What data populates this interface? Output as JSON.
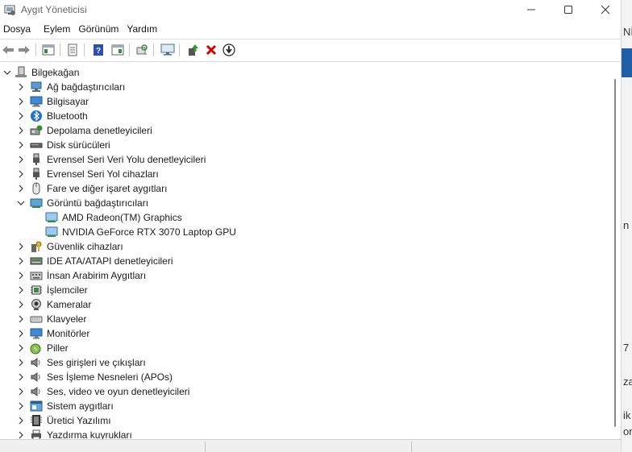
{
  "window": {
    "title": "Aygıt Yöneticisi"
  },
  "menu": [
    "Dosya",
    "Eylem",
    "Görünüm",
    "Yardım"
  ],
  "toolbar": [
    "back-arrow-icon",
    "forward-arrow-icon",
    "properties-pane-icon",
    "document-icon",
    "help-icon",
    "action-pane-icon",
    "scan-hardware-icon",
    "monitor-icon",
    "update-driver-icon",
    "uninstall-x-icon",
    "disable-down-arrow-icon"
  ],
  "tree": {
    "root": "Bilgekağan",
    "items": [
      {
        "label": "Ağ bağdaştırıcıları",
        "icon": "network-adapter-icon",
        "expanded": false
      },
      {
        "label": "Bilgisayar",
        "icon": "computer-icon",
        "expanded": false
      },
      {
        "label": "Bluetooth",
        "icon": "bluetooth-icon",
        "expanded": false
      },
      {
        "label": "Depolama denetleyicileri",
        "icon": "storage-controller-icon",
        "expanded": false
      },
      {
        "label": "Disk sürücüleri",
        "icon": "disk-drive-icon",
        "expanded": false
      },
      {
        "label": "Evrensel Seri Veri Yolu denetleyicileri",
        "icon": "usb-icon",
        "expanded": false
      },
      {
        "label": "Evrensel Seri Yol cihazları",
        "icon": "usb-icon",
        "expanded": false
      },
      {
        "label": "Fare ve diğer işaret aygıtları",
        "icon": "mouse-icon",
        "expanded": false
      },
      {
        "label": "Görüntü bağdaştırıcıları",
        "icon": "display-adapter-icon",
        "expanded": true,
        "children": [
          "AMD Radeon(TM) Graphics",
          "NVIDIA GeForce RTX 3070 Laptop GPU"
        ]
      },
      {
        "label": "Güvenlik cihazları",
        "icon": "security-device-icon",
        "expanded": false
      },
      {
        "label": "IDE ATA/ATAPI denetleyicileri",
        "icon": "ide-controller-icon",
        "expanded": false
      },
      {
        "label": "İnsan Arabirim Aygıtları",
        "icon": "hid-icon",
        "expanded": false
      },
      {
        "label": "İşlemciler",
        "icon": "processor-icon",
        "expanded": false
      },
      {
        "label": "Kameralar",
        "icon": "camera-icon",
        "expanded": false
      },
      {
        "label": "Klavyeler",
        "icon": "keyboard-icon",
        "expanded": false
      },
      {
        "label": "Monitörler",
        "icon": "monitor-icon",
        "expanded": false
      },
      {
        "label": "Piller",
        "icon": "battery-icon",
        "expanded": false
      },
      {
        "label": "Ses girişleri ve çıkışları",
        "icon": "speaker-icon",
        "expanded": false
      },
      {
        "label": "Ses İşleme Nesneleri (APOs)",
        "icon": "speaker-icon",
        "expanded": false
      },
      {
        "label": "Ses, video ve oyun denetleyicileri",
        "icon": "speaker-icon",
        "expanded": false
      },
      {
        "label": "Sistem aygıtları",
        "icon": "system-device-icon",
        "expanded": false
      },
      {
        "label": "Üretici Yazılımı",
        "icon": "firmware-icon",
        "expanded": false
      },
      {
        "label": "Yazdırma kuyrukları",
        "icon": "printer-icon",
        "expanded": false
      }
    ]
  },
  "background_edge": [
    "Nİ",
    "n",
    "za",
    "7",
    "ik",
    "on"
  ]
}
